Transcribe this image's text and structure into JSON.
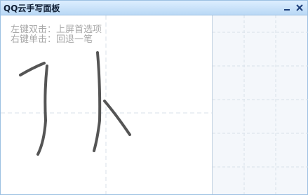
{
  "window": {
    "title": "QQ云手写面板",
    "minimize_icon": "minimize-icon",
    "close_icon": "close-icon"
  },
  "canvas": {
    "hint_line1": "左键双击：上屏首选项",
    "hint_line2": "右键单击：回退一笔"
  },
  "colors": {
    "title_bar": "#c9e2f8",
    "border": "#9cc0e2",
    "guide_line": "#d8e0ea",
    "ink": "#555555",
    "panel_bg": "#f4f7fb",
    "hint_text": "#a8a8a8"
  }
}
